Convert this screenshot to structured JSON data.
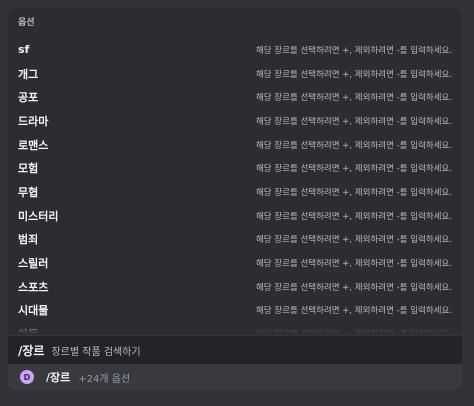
{
  "popup": {
    "header": "옵션",
    "options": [
      {
        "name": "sf",
        "desc": "해당 장르를 선택하려면 +, 제외하려면 -를 입력하세요."
      },
      {
        "name": "개그",
        "desc": "해당 장르를 선택하려면 +, 제외하려면 -를 입력하세요."
      },
      {
        "name": "공포",
        "desc": "해당 장르를 선택하려면 +, 제외하려면 -를 입력하세요."
      },
      {
        "name": "드라마",
        "desc": "해당 장르를 선택하려면 +, 제외하려면 -를 입력하세요."
      },
      {
        "name": "로맨스",
        "desc": "해당 장르를 선택하려면 +, 제외하려면 -를 입력하세요."
      },
      {
        "name": "모험",
        "desc": "해당 장르를 선택하려면 +, 제외하려면 -를 입력하세요."
      },
      {
        "name": "무협",
        "desc": "해당 장르를 선택하려면 +, 제외하려면 -를 입력하세요."
      },
      {
        "name": "미스터리",
        "desc": "해당 장르를 선택하려면 +, 제외하려면 -를 입력하세요."
      },
      {
        "name": "범죄",
        "desc": "해당 장르를 선택하려면 +, 제외하려면 -를 입력하세요."
      },
      {
        "name": "스릴러",
        "desc": "해당 장르를 선택하려면 +, 제외하려면 -를 입력하세요."
      },
      {
        "name": "스포츠",
        "desc": "해당 장르를 선택하려면 +, 제외하려면 -를 입력하세요."
      },
      {
        "name": "시대물",
        "desc": "해당 장르를 선택하려면 +, 제외하려면 -를 입력하세요."
      },
      {
        "name": "아동",
        "desc": "해당 장르를 선택하려면 +, 제외하려면 -를 입력하세요."
      }
    ]
  },
  "command": {
    "name": "/장르",
    "description": "장르별 작품 검색하기"
  },
  "input": {
    "app_icon_letter": "D",
    "command": "/장르",
    "more_options": "+24개 옵션"
  },
  "colors": {
    "background": "#313338",
    "popup": "#2b2d31",
    "input": "#383a40",
    "app_icon": "#c9a5f5"
  }
}
